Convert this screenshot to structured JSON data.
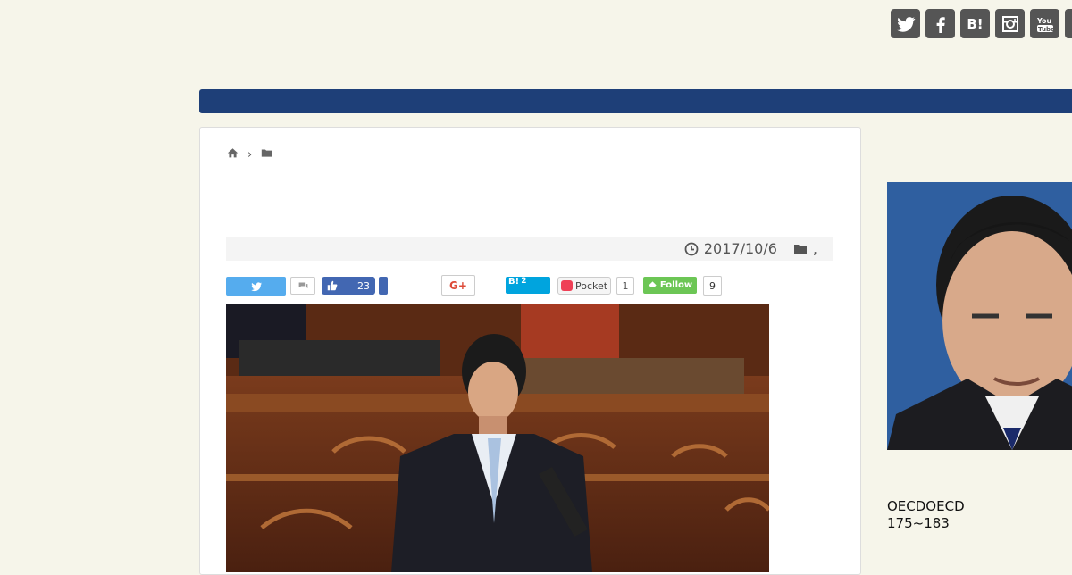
{
  "social_icons": [
    {
      "name": "twitter-icon",
      "glyph": ""
    },
    {
      "name": "facebook-icon",
      "glyph": ""
    },
    {
      "name": "hatena-bookmark-icon",
      "glyph": "B!"
    },
    {
      "name": "instagram-icon",
      "glyph": ""
    },
    {
      "name": "youtube-icon",
      "glyph": ""
    },
    {
      "name": "feedly-icon",
      "glyph": ""
    }
  ],
  "colors": {
    "navbar": "#1e3f78",
    "background": "#f6f5ea",
    "twitter": "#55acee",
    "facebook": "#4267b2",
    "hatena": "#00a4de",
    "pocket": "#ef4056",
    "feedly": "#6cc655"
  },
  "breadcrumb": {
    "home_icon": "home-icon",
    "separator": "›",
    "folder_icon": "folder-icon"
  },
  "meta": {
    "date": "2017/10/6",
    "category_separator": ","
  },
  "share": {
    "facebook_count": "23",
    "google_label": "G+",
    "hatena_label": "B!",
    "hatena_count": "2",
    "pocket_label": "Pocket",
    "pocket_count": "1",
    "feedly_label": "Follow",
    "feedly_count": "9"
  },
  "sidebar": {
    "text_line1": "OECDOECD",
    "text_line2": "175~183"
  }
}
